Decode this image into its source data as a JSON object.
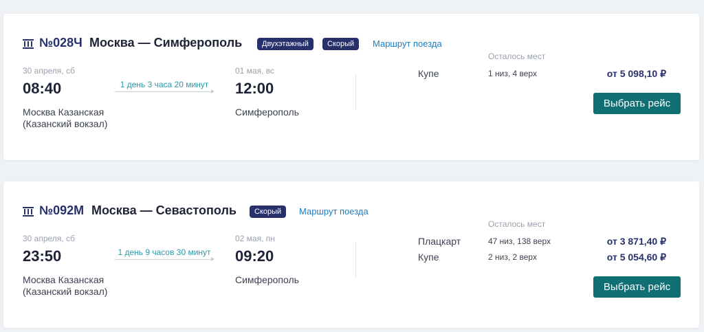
{
  "trains": [
    {
      "number": "№028Ч",
      "route": "Москва — Симферополь",
      "badges": [
        "Двухэтажный",
        "Скорый"
      ],
      "route_link": "Маршрут поезда",
      "departure": {
        "date": "30 апреля, сб",
        "time": "08:40",
        "station": "Москва Казанская (Казанский вокзал)"
      },
      "duration": "1 день 3 часа 20 минут",
      "arrival": {
        "date": "01 мая, вс",
        "time": "12:00",
        "station": "Симферополь"
      },
      "seats_header": "Осталось мест",
      "classes": [
        {
          "name": "Купе",
          "seats": "1 низ, 4 верх",
          "price": "от 5 098,10 ₽"
        }
      ],
      "button": "Выбрать рейс"
    },
    {
      "number": "№092М",
      "route": "Москва — Севастополь",
      "badges": [
        "Скорый"
      ],
      "route_link": "Маршрут поезда",
      "departure": {
        "date": "30 апреля, сб",
        "time": "23:50",
        "station": "Москва Казанская (Казанский вокзал)"
      },
      "duration": "1 день 9 часов 30 минут",
      "arrival": {
        "date": "02 мая, пн",
        "time": "09:20",
        "station": "Симферополь"
      },
      "seats_header": "Осталось мест",
      "classes": [
        {
          "name": "Плацкарт",
          "seats": "47 низ, 138 верх",
          "price": "от 3 871,40 ₽"
        },
        {
          "name": "Купе",
          "seats": "2 низ, 2 верх",
          "price": "от 5 054,60 ₽"
        }
      ],
      "button": "Выбрать рейс"
    }
  ],
  "colors": {
    "brand": "#26306b",
    "button": "#0f6f73",
    "link": "#1f7cc1",
    "duration": "#2a9aa8"
  },
  "icons": {
    "train": "train-icon"
  }
}
